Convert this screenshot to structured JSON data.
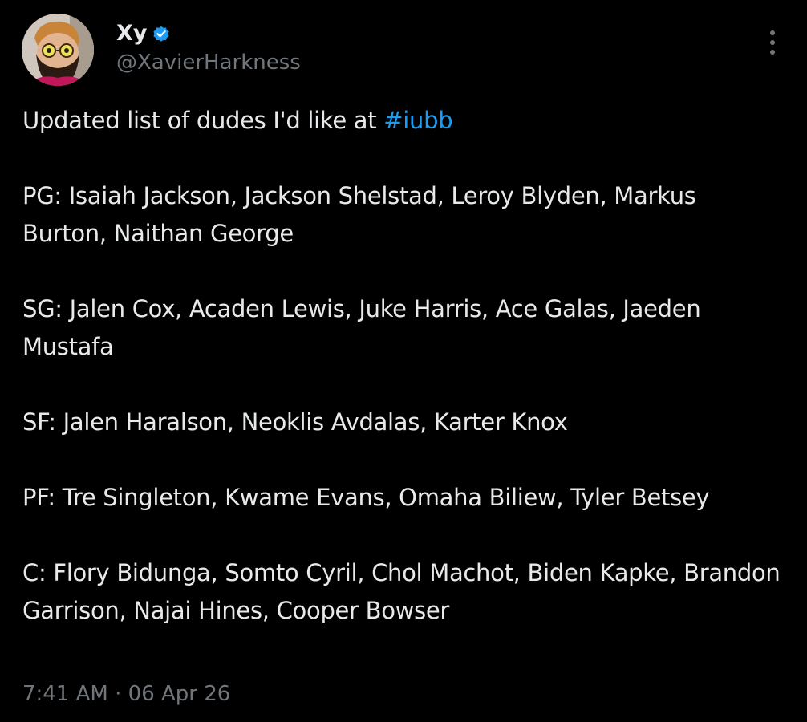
{
  "author": {
    "display_name": "Xy",
    "handle": "@XavierHarkness",
    "verified_color": "#1d9bf0",
    "avatar_icon": "profile-photo"
  },
  "tweet": {
    "intro": "Updated list of dudes I'd like at ",
    "hashtag": "#iubb",
    "paragraphs": [
      "PG: Isaiah Jackson, Jackson Shelstad, Leroy Blyden, Markus Burton, Naithan George",
      "SG: Jalen Cox, Acaden Lewis, Juke Harris, Ace Galas, Jaeden Mustafa",
      "SF: Jalen Haralson, Neoklis Avdalas, Karter Knox",
      "PF: Tre Singleton, Kwame Evans, Omaha Biliew, Tyler Betsey",
      "C: Flory Bidunga, Somto Cyril, Chol Machot, Biden Kapke, Brandon Garrison, Najai Hines, Cooper Bowser"
    ]
  },
  "meta": {
    "time": "7:41 AM",
    "separator": " · ",
    "date": "06 Apr 26"
  },
  "colors": {
    "background": "#000000",
    "text": "#e7e9ea",
    "secondary": "#71767b",
    "link": "#1d9bf0"
  },
  "icons": {
    "more": "more-vertical-icon",
    "verified": "verified-badge-icon"
  }
}
